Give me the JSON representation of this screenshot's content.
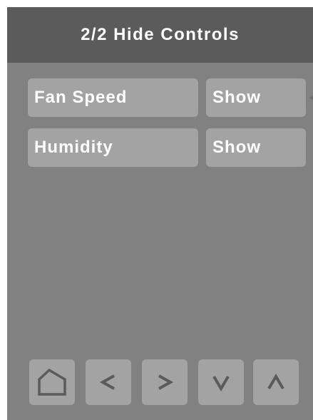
{
  "header": {
    "title": "2/2 Hide Controls"
  },
  "rows": [
    {
      "label": "Fan Speed",
      "value": "Show"
    },
    {
      "label": "Humidity",
      "value": "Show"
    }
  ],
  "nav": {
    "icons": [
      "home-icon",
      "chevron-left-icon",
      "chevron-right-icon",
      "chevron-down-icon",
      "chevron-up-icon"
    ]
  },
  "colors": {
    "background": "#818181",
    "header": "#5b5b5b",
    "button": "#a3a3a3",
    "text": "#ffffff",
    "icon": "#5b5b5b"
  }
}
